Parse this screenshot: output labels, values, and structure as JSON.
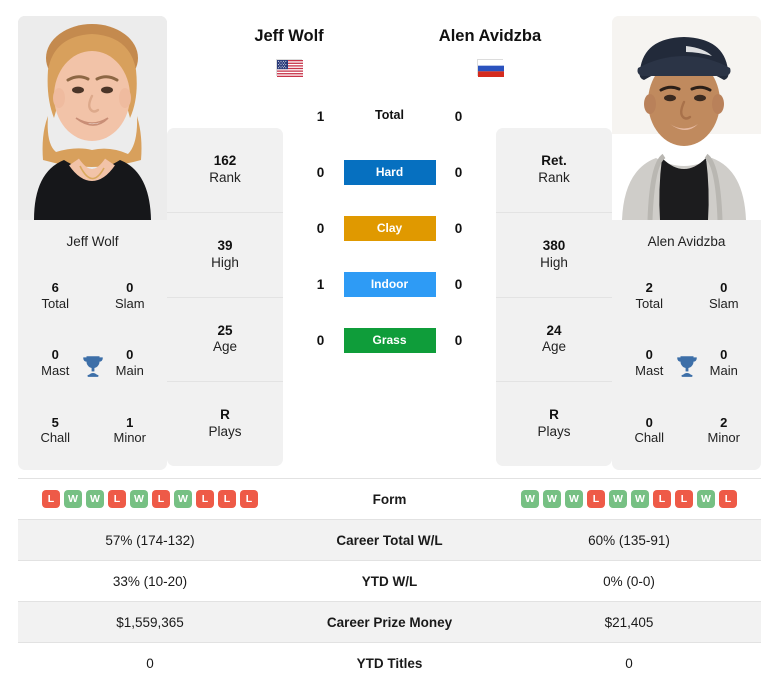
{
  "players": {
    "left": {
      "name": "Jeff Wolf",
      "name_caption": "Jeff Wolf",
      "flag": "us-flag-icon",
      "flag_country": "United States",
      "titles": [
        {
          "num": "6",
          "label": "Total"
        },
        {
          "num": "0",
          "label": "Slam"
        },
        {
          "num": "0",
          "label": "Mast"
        },
        {
          "num": "0",
          "label": "Main"
        },
        {
          "num": "5",
          "label": "Chall"
        },
        {
          "num": "1",
          "label": "Minor"
        }
      ],
      "stats": [
        {
          "num": "162",
          "label": "Rank"
        },
        {
          "num": "39",
          "label": "High"
        },
        {
          "num": "25",
          "label": "Age"
        },
        {
          "num": "R",
          "label": "Plays"
        }
      ],
      "form": [
        "L",
        "W",
        "W",
        "L",
        "W",
        "L",
        "W",
        "L",
        "L",
        "L"
      ],
      "career_total_wl": "57% (174-132)",
      "ytd_wl": "33% (10-20)",
      "career_prize_money": "$1,559,365",
      "ytd_titles": "0"
    },
    "right": {
      "name": "Alen Avidzba",
      "name_caption": "Alen Avidzba",
      "flag": "ru-flag-icon",
      "flag_country": "Russia",
      "titles": [
        {
          "num": "2",
          "label": "Total"
        },
        {
          "num": "0",
          "label": "Slam"
        },
        {
          "num": "0",
          "label": "Mast"
        },
        {
          "num": "0",
          "label": "Main"
        },
        {
          "num": "0",
          "label": "Chall"
        },
        {
          "num": "2",
          "label": "Minor"
        }
      ],
      "stats": [
        {
          "num": "Ret.",
          "label": "Rank"
        },
        {
          "num": "380",
          "label": "High"
        },
        {
          "num": "24",
          "label": "Age"
        },
        {
          "num": "R",
          "label": "Plays"
        }
      ],
      "form": [
        "W",
        "W",
        "W",
        "L",
        "W",
        "W",
        "L",
        "L",
        "W",
        "L"
      ],
      "career_total_wl": "60% (135-91)",
      "ytd_wl": "0% (0-0)",
      "career_prize_money": "$21,405",
      "ytd_titles": "0"
    }
  },
  "head_to_head": [
    {
      "label": "Total",
      "left": "1",
      "right": "0",
      "color": "transparent",
      "plain": true
    },
    {
      "label": "Hard",
      "left": "0",
      "right": "0",
      "color": "#0670c0",
      "plain": false
    },
    {
      "label": "Clay",
      "left": "0",
      "right": "0",
      "color": "#e09900",
      "plain": false
    },
    {
      "label": "Indoor",
      "left": "1",
      "right": "0",
      "color": "#2e9bf5",
      "plain": false
    },
    {
      "label": "Grass",
      "left": "0",
      "right": "0",
      "color": "#0f9d3a",
      "plain": false
    }
  ],
  "table_rows": [
    {
      "label": "Form",
      "type": "form",
      "shade": false
    },
    {
      "label": "Career Total W/L",
      "type": "text",
      "key": "career_total_wl",
      "shade": true
    },
    {
      "label": "YTD W/L",
      "type": "text",
      "key": "ytd_wl",
      "shade": false
    },
    {
      "label": "Career Prize Money",
      "type": "text",
      "key": "career_prize_money",
      "shade": true
    },
    {
      "label": "YTD Titles",
      "type": "text",
      "key": "ytd_titles",
      "shade": false
    }
  ],
  "colors": {
    "hard": "#0670c0",
    "clay": "#e09900",
    "indoor": "#2e9bf5",
    "grass": "#0f9d3a",
    "win": "#76c083",
    "loss": "#ee5a47",
    "trophy": "#3d6fa8",
    "card_bg": "#f1f1f1",
    "row_shade": "#f2f2f2"
  },
  "icons": {
    "trophy": "trophy-icon"
  }
}
